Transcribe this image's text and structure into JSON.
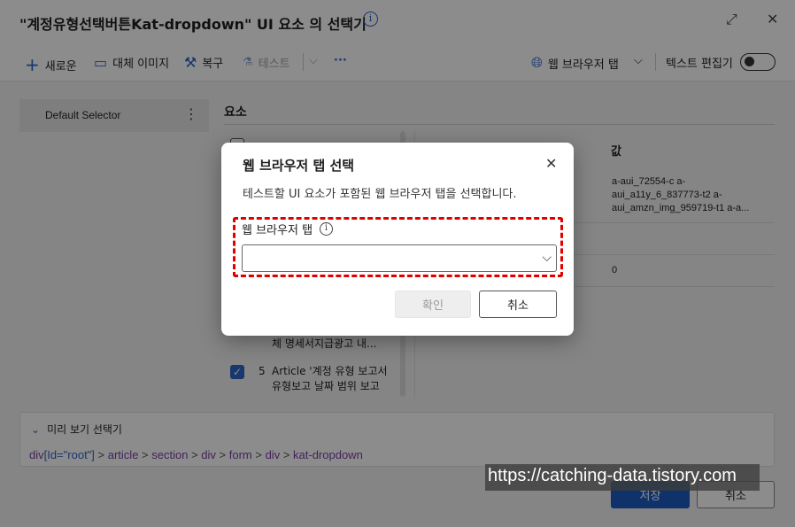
{
  "window": {
    "title": "\"계정유형선택버튼Kat-dropdown\" UI 요소 의 선택기",
    "info_icon": "info-icon"
  },
  "toolbar": {
    "new_label": "새로운",
    "alt_image_label": "대체 이미지",
    "repair_label": "복구",
    "test_label": "테스트",
    "more_label": "···",
    "browser_tab_label": "웹 브라우저 탭",
    "text_editor_label": "텍스트 편집기"
  },
  "selectors": {
    "items": [
      {
        "label": "Default Selector"
      }
    ]
  },
  "elements": {
    "section_title": "요소",
    "rows": [
      {
        "text": "체 명세서지급광고 내...",
        "checked": null
      },
      {
        "number": "5",
        "text_line1": "Article '계정 유형 보고서",
        "text_line2": "유형보고 날짜 범위 보고",
        "checked": true
      }
    ]
  },
  "attributes": {
    "value_header": "값",
    "values": [
      "a-aui_72554-c a-aui_a11y_6_837773-t2 a-aui_amzn_img_959719-t1 a-a...",
      "0"
    ]
  },
  "preview": {
    "title": "미리 보기 선택기",
    "path": [
      {
        "text": "div",
        "kind": "tag"
      },
      {
        "text": "[Id=\"root\"]",
        "kind": "attr"
      },
      {
        "text": " > ",
        "kind": "sep"
      },
      {
        "text": "article",
        "kind": "tag"
      },
      {
        "text": " > ",
        "kind": "sep"
      },
      {
        "text": "section",
        "kind": "tag"
      },
      {
        "text": " > ",
        "kind": "sep"
      },
      {
        "text": "div",
        "kind": "tag"
      },
      {
        "text": " > ",
        "kind": "sep"
      },
      {
        "text": "form",
        "kind": "tag"
      },
      {
        "text": " > ",
        "kind": "sep"
      },
      {
        "text": "div",
        "kind": "tag"
      },
      {
        "text": " > ",
        "kind": "sep"
      },
      {
        "text": "kat-dropdown",
        "kind": "tag"
      }
    ]
  },
  "footer": {
    "save_label": "저장",
    "cancel_label": "취소"
  },
  "modal": {
    "title": "웹 브라우저 탭 선택",
    "description": "테스트할 UI 요소가 포함된 웹 브라우저 탭을 선택합니다.",
    "field_label": "웹 브라우저 탭",
    "select_value": "",
    "ok_label": "확인",
    "cancel_label": "취소"
  },
  "watermark": "https://catching-data.tistory.com",
  "colors": {
    "accent": "#2c64c8",
    "primary_button": "#1d5bc4",
    "highlight_dash": "#e00000",
    "tag_purple": "#7a3ea8"
  }
}
